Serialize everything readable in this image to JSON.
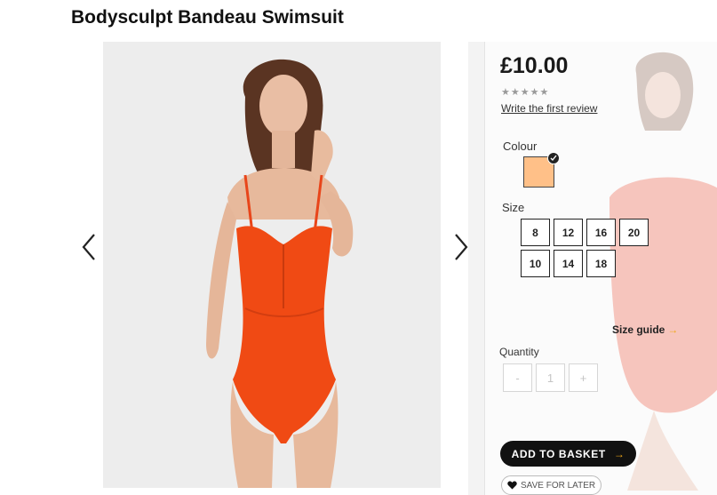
{
  "product": {
    "title": "Bodysculpt Bandeau Swimsuit",
    "price": "£10.00",
    "rating": {
      "value": 0,
      "max": 5,
      "star": "★"
    },
    "review_link": "Write the first review"
  },
  "colour": {
    "label": "Colour",
    "selected_hex": "#ffc088",
    "check_glyph": "✓"
  },
  "size": {
    "label": "Size",
    "options": [
      "8",
      "12",
      "16",
      "20",
      "10",
      "14",
      "18"
    ],
    "guide_label": "Size guide",
    "guide_arrow": "→"
  },
  "quantity": {
    "label": "Quantity",
    "minus": "-",
    "value": "1",
    "plus": "+"
  },
  "actions": {
    "add_to_basket": "ADD TO BASKET",
    "add_arrow": "→",
    "save_for_later": "SAVE FOR LATER"
  },
  "colors": {
    "swimsuit": "#f04a14",
    "accent": "#f0a818",
    "button": "#111111"
  },
  "icons": [
    "chevron-left-icon",
    "chevron-right-icon",
    "star-icon",
    "checkmark-icon",
    "heart-icon",
    "arrow-right-icon"
  ]
}
